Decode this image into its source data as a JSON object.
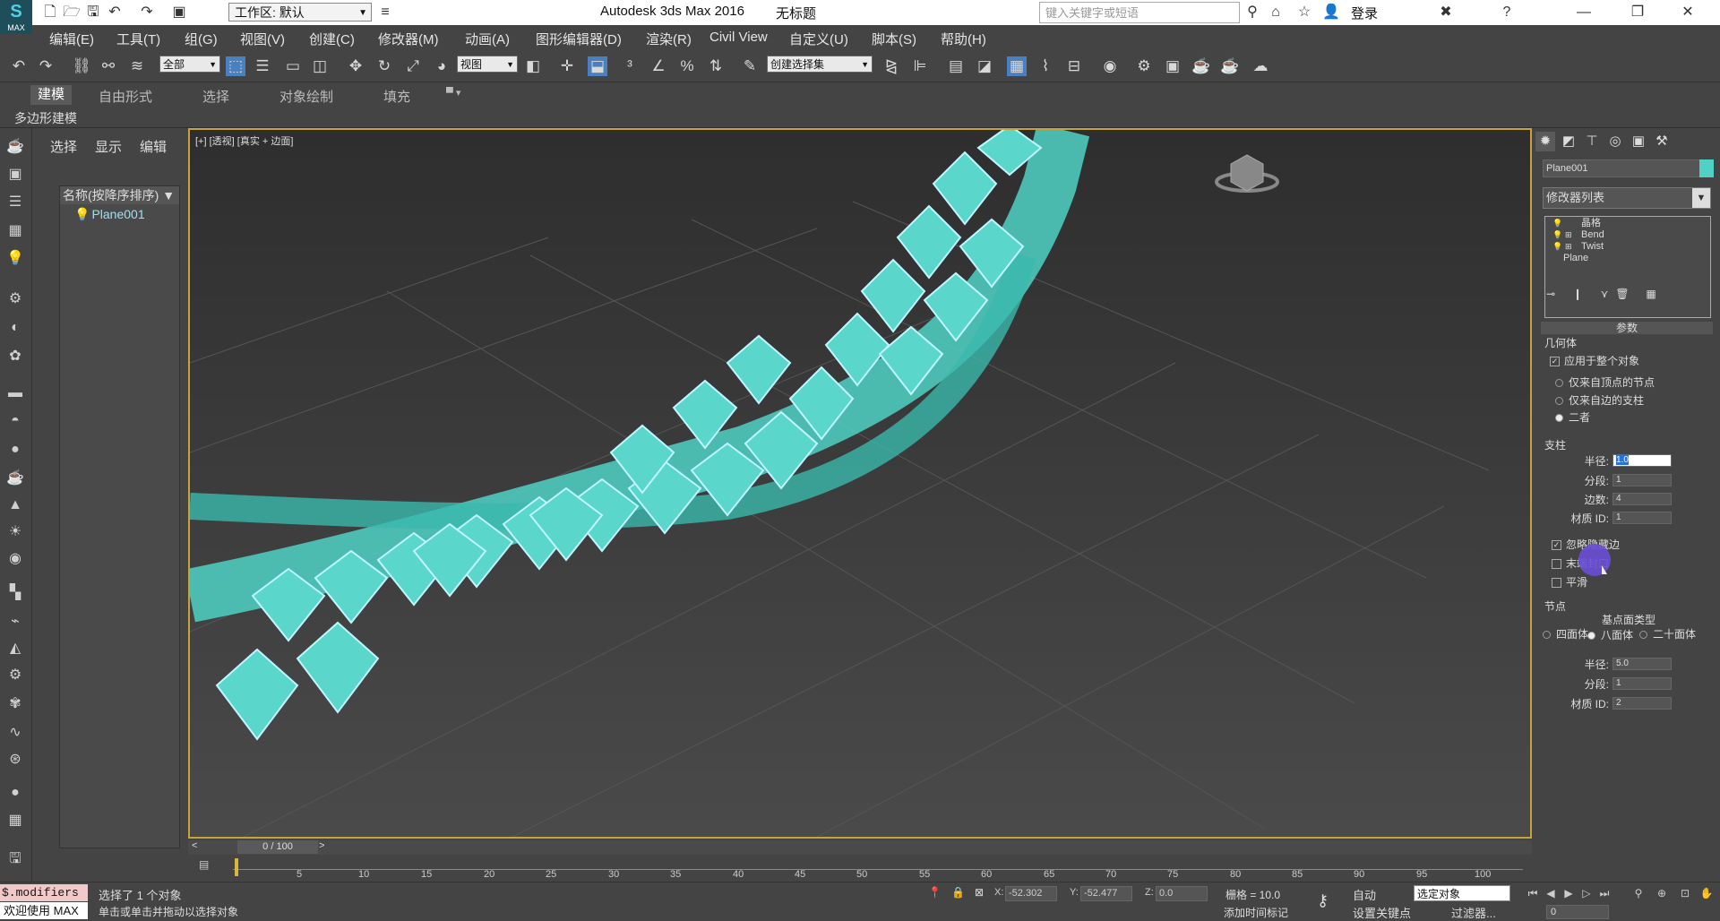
{
  "title_bar": {
    "logo_text": "MAX",
    "workspace_label": "工作区: 默认",
    "app_title": "Autodesk 3ds Max 2016",
    "doc_title": "无标题",
    "search_placeholder": "键入关键字或短语",
    "login_label": "登录"
  },
  "menu": [
    "编辑(E)",
    "工具(T)",
    "组(G)",
    "视图(V)",
    "创建(C)",
    "修改器(M)",
    "动画(A)",
    "图形编辑器(D)",
    "渲染(R)",
    "Civil View",
    "自定义(U)",
    "脚本(S)",
    "帮助(H)"
  ],
  "toolbar": {
    "filter_select": "全部",
    "ref_coord_select": "视图",
    "named_sel_select": "创建选择集"
  },
  "ribbon": {
    "tabs": [
      "建模",
      "自由形式",
      "选择",
      "对象绘制",
      "填充"
    ],
    "active_tab": "建模",
    "subpanel": "多边形建模"
  },
  "explorer": {
    "tabs": [
      "选择",
      "显示",
      "编辑"
    ],
    "header": "名称(按降序排序)",
    "items": [
      "Plane001"
    ]
  },
  "viewport": {
    "label": "[+] [透视] [真实 + 边面]",
    "model_color": "#4fd2c5",
    "border_color": "#c7a43a"
  },
  "timeline": {
    "frame_label": "0 / 100",
    "ticks": [
      "5",
      "10",
      "15",
      "20",
      "25",
      "30",
      "35",
      "40",
      "45",
      "50",
      "55",
      "60",
      "65",
      "70",
      "75",
      "80",
      "85",
      "90",
      "95",
      "100"
    ]
  },
  "status": {
    "maxscript_input": "$.modifiers",
    "maxscript_output": "欢迎使用 MAX",
    "line1": "选择了 1 个对象",
    "line2": "单击或单击并拖动以选择对象",
    "x_label": "X:",
    "x_value": "-52.302",
    "y_label": "Y:",
    "y_value": "-52.477",
    "z_label": "Z:",
    "z_value": "0.0",
    "grid": "栅格 = 10.0",
    "auto_key": "自动",
    "set_key": "设置关键点",
    "key_mode": "选定对象",
    "filters": "过滤器...",
    "add_time_tag": "添加时间标记",
    "frame_value": "0"
  },
  "command_panel": {
    "object_name": "Plane001",
    "modifier_list": "修改器列表",
    "stack": [
      "晶格",
      "Bend",
      "Twist",
      "Plane"
    ],
    "rollout_title": "参数",
    "geometry": {
      "group": "几何体",
      "apply_all": "应用于整个对象",
      "opt_joints": "仅来自顶点的节点",
      "opt_struts": "仅来自边的支柱",
      "opt_both": "二者"
    },
    "struts": {
      "group": "支柱",
      "radius_label": "半径:",
      "radius_value": "1.0",
      "segments_label": "分段:",
      "segments_value": "1",
      "sides_label": "边数:",
      "sides_value": "4",
      "matid_label": "材质 ID:",
      "matid_value": "1",
      "ignore_hidden": "忽略隐藏边",
      "end_caps": "末端封口",
      "smooth": "平滑"
    },
    "joints": {
      "group": "节点",
      "base_type_label": "基点面类型",
      "tetra": "四面体",
      "octa": "八面体",
      "icosa": "二十面体",
      "radius_label": "半径:",
      "radius_value": "5.0",
      "segments_label": "分段:",
      "segments_value": "1",
      "matid_label": "材质 ID:",
      "matid_value": "2"
    }
  }
}
